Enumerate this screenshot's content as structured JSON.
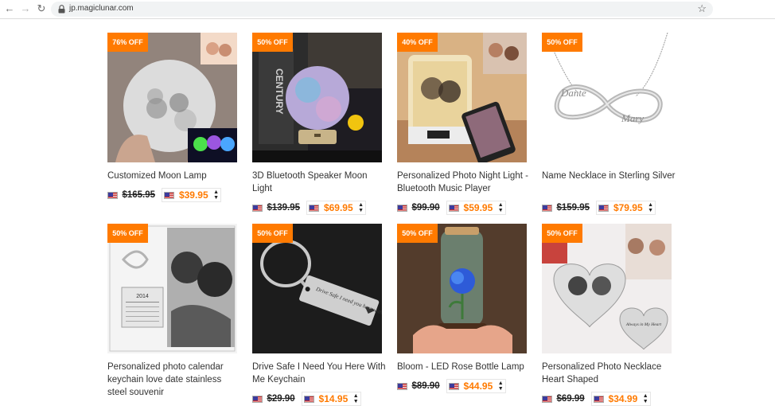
{
  "browser": {
    "url": "jp.magiclunar.com"
  },
  "colors": {
    "badge": "#ff7a00",
    "price": "#ff7a00"
  },
  "products": [
    {
      "discount": "76% OFF",
      "title": "Customized Moon Lamp",
      "old_price": "$165.95",
      "new_price": "$39.95"
    },
    {
      "discount": "50% OFF",
      "title": "3D Bluetooth Speaker Moon Light",
      "old_price": "$139.95",
      "new_price": "$69.95"
    },
    {
      "discount": "40% OFF",
      "title": "Personalized Photo Night Light - Bluetooth Music Player",
      "old_price": "$99.90",
      "new_price": "$59.95"
    },
    {
      "discount": "50% OFF",
      "title": "Name Necklace in Sterling Silver",
      "old_price": "$159.95",
      "new_price": "$79.95"
    },
    {
      "discount": "50% OFF",
      "title": "Personalized photo calendar keychain love date stainless steel souvenir",
      "old_price": "",
      "new_price": ""
    },
    {
      "discount": "50% OFF",
      "title": "Drive Safe I Need You Here With Me Keychain",
      "old_price": "$29.90",
      "new_price": "$14.95"
    },
    {
      "discount": "50% OFF",
      "title": "Bloom - LED Rose Bottle Lamp",
      "old_price": "$89.90",
      "new_price": "$44.95"
    },
    {
      "discount": "50% OFF",
      "title": "Personalized Photo Necklace Heart Shaped",
      "old_price": "$69.99",
      "new_price": "$34.99"
    }
  ],
  "images": {
    "p2_text": "CENTURY",
    "p6_text": "Drive Safe I need you here with me",
    "p8_text": "Always in My Heart",
    "calendar_year": "2014"
  }
}
